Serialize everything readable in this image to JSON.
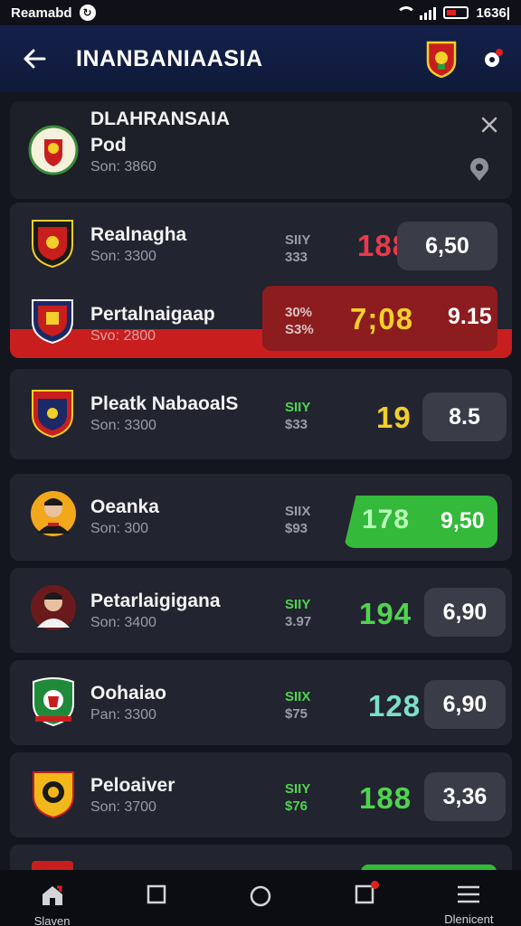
{
  "status_bar": {
    "carrier": "Reamabd",
    "time": "1636|"
  },
  "header": {
    "title": "INANBANIAASIA"
  },
  "featured": {
    "name_line1": "DLAHRANSAIA",
    "name_line2": "Pod",
    "sub": "Son: 3860"
  },
  "rows": [
    {
      "name": "Realnagha",
      "sub": "Son: 3300",
      "mini1": "SIIY",
      "mini2": "333",
      "score": "188",
      "odds": "6,50"
    },
    {
      "name": "Pertalnaigaap",
      "sub": "Svo: 2800",
      "mini1": "30%",
      "mini2": "S3%",
      "score": "7;08",
      "odds": "9.15"
    },
    {
      "name": "Pleatk NabaoalS",
      "sub": "Son: 3300",
      "mini1": "SIIY",
      "mini2": "$33",
      "score": "19",
      "odds": "8.5"
    },
    {
      "name": "Oeanka",
      "sub": "Son: 300",
      "mini1": "SIIX",
      "mini2": "$93",
      "score": "178",
      "odds": "9,50"
    },
    {
      "name": "Petarlaigigana",
      "sub": "Son: 3400",
      "mini1": "SIIY",
      "mini2": "3.97",
      "score": "194",
      "odds": "6,90"
    },
    {
      "name": "Oohaiao",
      "sub": "Pan: 3300",
      "mini1": "SIIX",
      "mini2": "$75",
      "score": "128",
      "odds": "6,90"
    },
    {
      "name": "Peloaiver",
      "sub": "Son: 3700",
      "mini1": "SIIY",
      "mini2": "$76",
      "score": "188",
      "odds": "3,36"
    }
  ],
  "bottom_nav": {
    "home_label": "Slaven",
    "menu_label": "Dlenicent"
  },
  "colors": {
    "accent_green": "#3ac43a",
    "accent_red": "#c81e1e",
    "score_yellow": "#f2cf2a",
    "score_green": "#4fe08a",
    "header_bg": "#14204a"
  }
}
